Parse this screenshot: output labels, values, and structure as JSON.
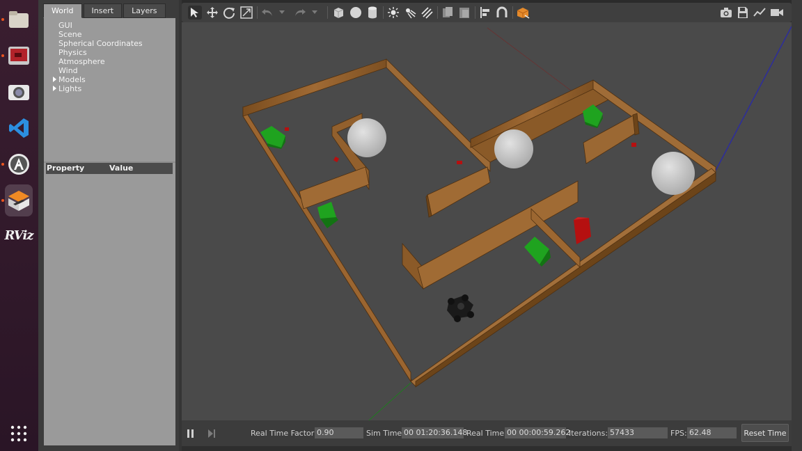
{
  "dock": {
    "items": [
      {
        "icon": "files-icon"
      },
      {
        "icon": "screen-recorder-icon"
      },
      {
        "icon": "camera-app-icon"
      },
      {
        "icon": "vscode-icon"
      },
      {
        "icon": "software-center-icon"
      },
      {
        "icon": "gazebo-icon"
      },
      {
        "label": "RViz",
        "icon": "rviz-icon"
      }
    ],
    "apps_grid_icon": "apps-grid-icon"
  },
  "left_panel": {
    "tabs": [
      "World",
      "Insert",
      "Layers"
    ],
    "active_tab": "World",
    "tree": [
      "GUI",
      "Scene",
      "Spherical Coordinates",
      "Physics",
      "Atmosphere",
      "Wind",
      "Models",
      "Lights"
    ],
    "property_header": {
      "property": "Property",
      "value": "Value"
    }
  },
  "toolbar": {
    "icons": [
      "select-arrow-icon",
      "translate-icon",
      "rotate-icon",
      "scale-icon",
      "undo-icon",
      "undo-dropdown-icon",
      "redo-icon",
      "redo-dropdown-icon",
      "box-shape-icon",
      "sphere-shape-icon",
      "cylinder-shape-icon",
      "point-light-icon",
      "spot-light-icon",
      "directional-light-icon",
      "copy-icon",
      "paste-icon",
      "align-icon",
      "snap-icon",
      "view-angle-icon",
      "screenshot-icon",
      "log-icon",
      "plot-icon",
      "record-video-icon"
    ]
  },
  "bottom_bar": {
    "real_time_factor_label": "Real Time Factor:",
    "real_time_factor": "0.90",
    "sim_time_label": "Sim Time:",
    "sim_time": "00 01:20:36.148",
    "real_time_label": "Real Time:",
    "real_time": "00 00:00:59.262",
    "iterations_label": "Iterations:",
    "iterations": "57433",
    "fps_label": "FPS:",
    "fps": "62.48",
    "reset_label": "Reset Time"
  },
  "colors": {
    "wall": "#8a5a26",
    "green_box": "#1fa31f",
    "red_box": "#b51010",
    "sphere": "#c8c8c8",
    "accent": "#e95420"
  }
}
